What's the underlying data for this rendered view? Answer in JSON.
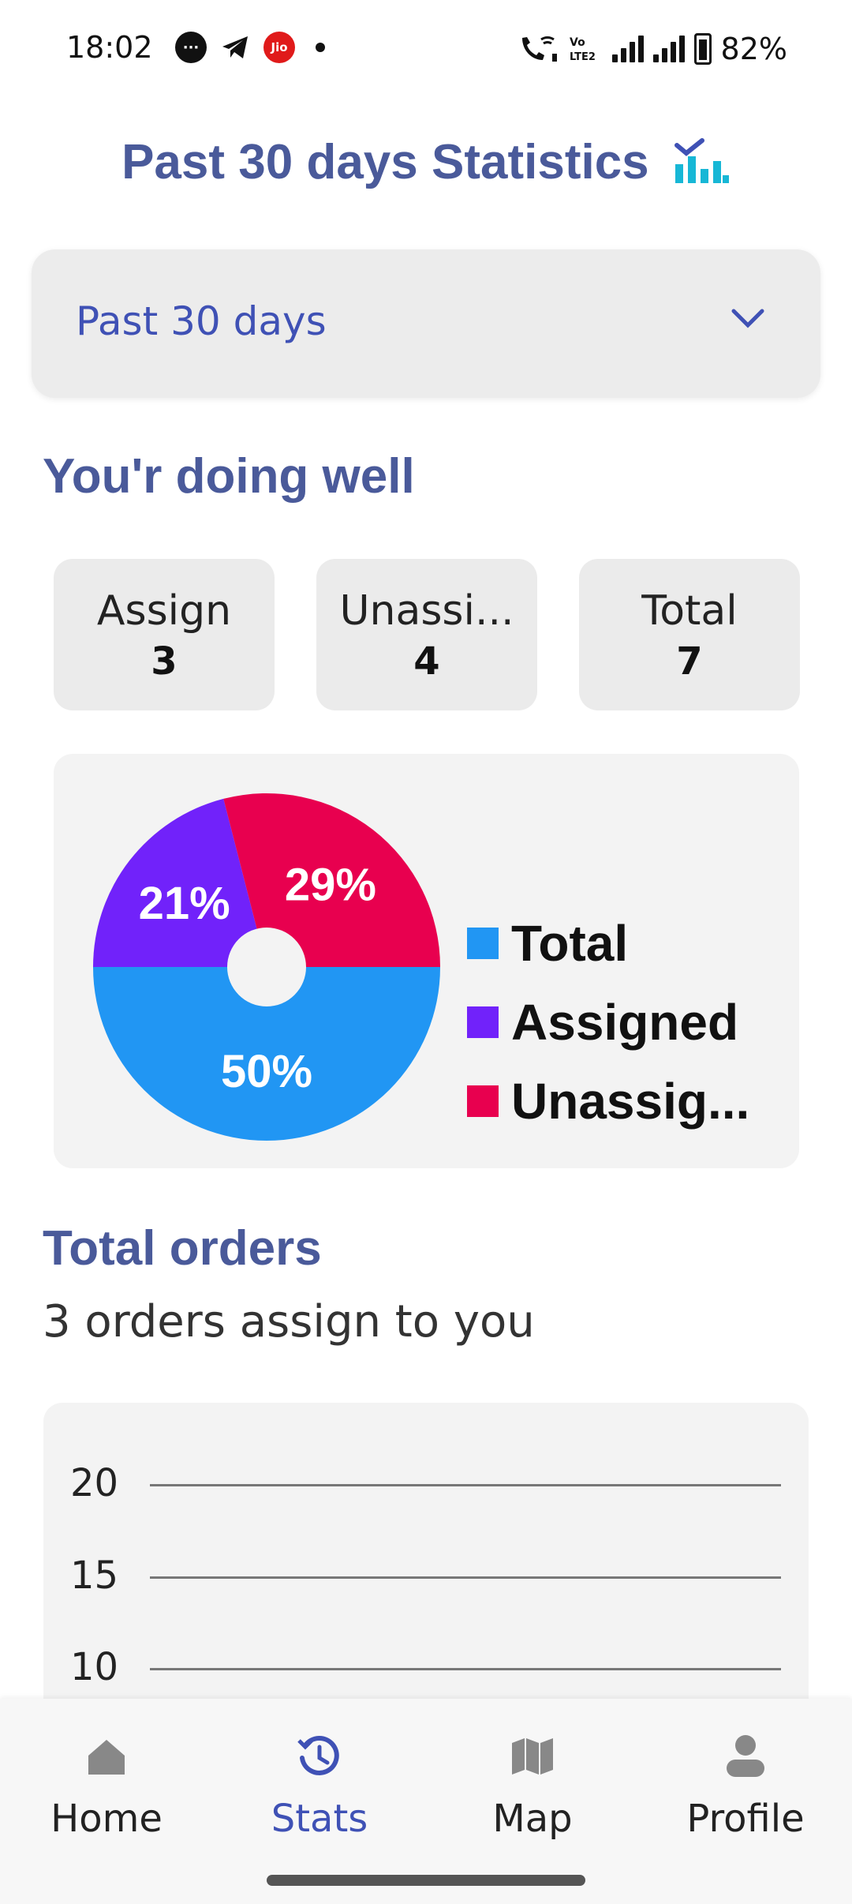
{
  "status_bar": {
    "time": "18:02",
    "battery": "82%",
    "jio_label": "Jio"
  },
  "header": {
    "title": "Past 30 days Statistics",
    "title_icon": "stats-chart-icon"
  },
  "period_select": {
    "value": "Past 30 days",
    "icon": "chevron-down-icon"
  },
  "summary": {
    "heading": "You'r doing well",
    "cards": [
      {
        "label": "Assign",
        "value": "3"
      },
      {
        "label": "Unassi...",
        "value": "4"
      },
      {
        "label": "Total",
        "value": "7"
      }
    ]
  },
  "chart_data": [
    {
      "type": "pie",
      "slices": [
        {
          "name": "Total",
          "value": 50,
          "label": "50%",
          "color": "#2196f3"
        },
        {
          "name": "Assigned",
          "value": 21,
          "label": "21%",
          "color": "#7122fa"
        },
        {
          "name": "Unassig...",
          "value": 29,
          "label": "29%",
          "color": "#e8004f"
        }
      ],
      "legend": [
        "Total",
        "Assigned",
        "Unassig..."
      ],
      "legend_position": "right"
    },
    {
      "type": "line",
      "yticks": [
        "20",
        "15",
        "10"
      ],
      "grid": true
    }
  ],
  "orders": {
    "heading": "Total orders",
    "subtitle": "3 orders assign to you"
  },
  "nav": {
    "items": [
      {
        "label": "Home",
        "icon": "home-icon",
        "active": false
      },
      {
        "label": "Stats",
        "icon": "history-icon",
        "active": true
      },
      {
        "label": "Map",
        "icon": "map-icon",
        "active": false
      },
      {
        "label": "Profile",
        "icon": "person-icon",
        "active": false
      }
    ]
  },
  "colors": {
    "accent": "#3f51b5",
    "heading": "#4a5a9a"
  }
}
